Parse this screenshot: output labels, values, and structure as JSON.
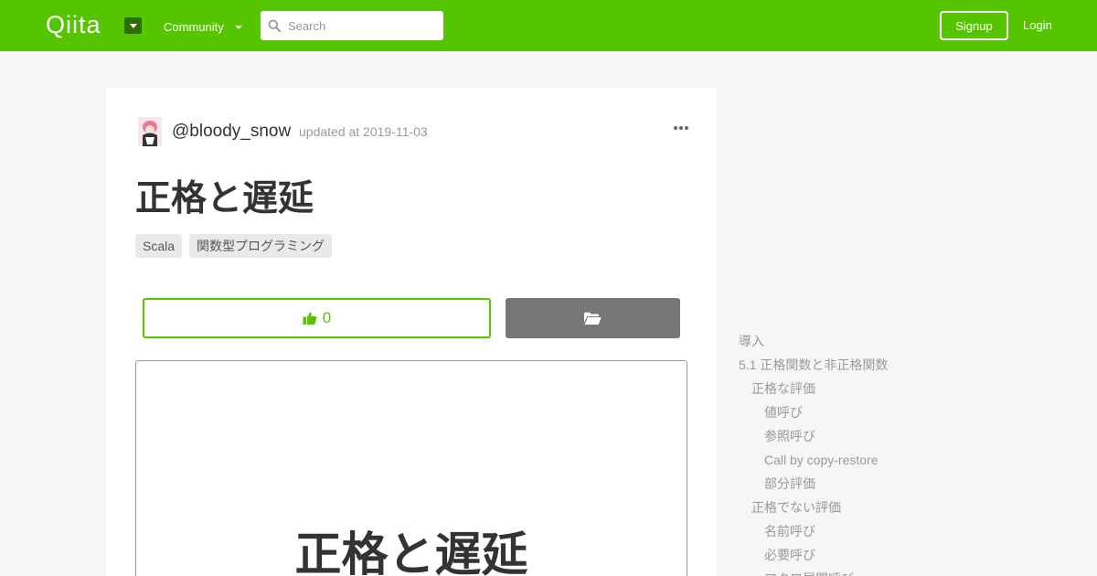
{
  "header": {
    "logo": "Qiita",
    "community_label": "Community",
    "search_placeholder": "Search",
    "signup_label": "Signup",
    "login_label": "Login",
    "brand_color": "#55c500"
  },
  "article": {
    "author": "@bloody_snow",
    "updated": "updated at 2019-11-03",
    "title": "正格と遅延",
    "tags": [
      "Scala",
      "関数型プログラミング"
    ],
    "like_count": "0",
    "cover_title": "正格と遅延"
  },
  "toc": [
    {
      "label": "導入",
      "level": 1
    },
    {
      "label": "5.1 正格関数と非正格関数",
      "level": 1
    },
    {
      "label": "正格な評価",
      "level": 2
    },
    {
      "label": "値呼び",
      "level": 3
    },
    {
      "label": "参照呼び",
      "level": 3
    },
    {
      "label": "Call by copy-restore",
      "level": 3
    },
    {
      "label": "部分評価",
      "level": 3
    },
    {
      "label": "正格でない評価",
      "level": 2
    },
    {
      "label": "名前呼び",
      "level": 3
    },
    {
      "label": "必要呼び",
      "level": 3
    },
    {
      "label": "マクロ展開呼び",
      "level": 3
    }
  ]
}
